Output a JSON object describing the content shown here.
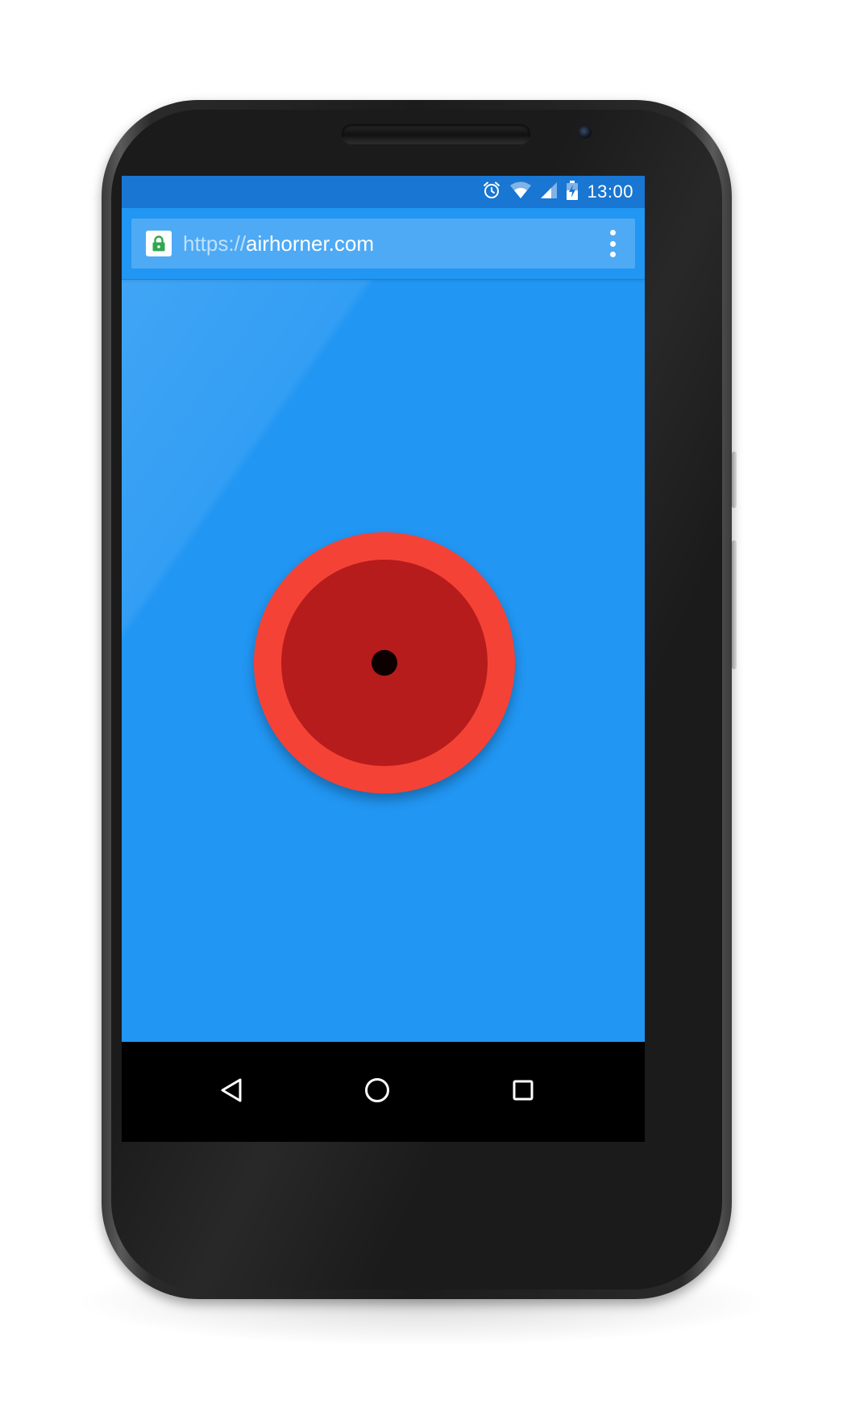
{
  "device": {
    "name": "android-phone"
  },
  "status_bar": {
    "time": "13:00",
    "icons": [
      "alarm-icon",
      "wifi-icon",
      "cell-signal-icon",
      "battery-charging-icon"
    ]
  },
  "browser": {
    "url_scheme": "https://",
    "url_host": "airhorner.com",
    "secure_icon": "lock-icon",
    "menu_icon": "more-vert-icon"
  },
  "app": {
    "button_icon": "air-horn-button",
    "colors": {
      "background": "#2196f3",
      "status_bar": "#1976d2",
      "horn_outer": "#f44336",
      "horn_inner": "#b71c1c",
      "horn_center": "#0d0000"
    }
  },
  "nav_bar": {
    "buttons": [
      "back-icon",
      "home-icon",
      "recents-icon"
    ]
  }
}
